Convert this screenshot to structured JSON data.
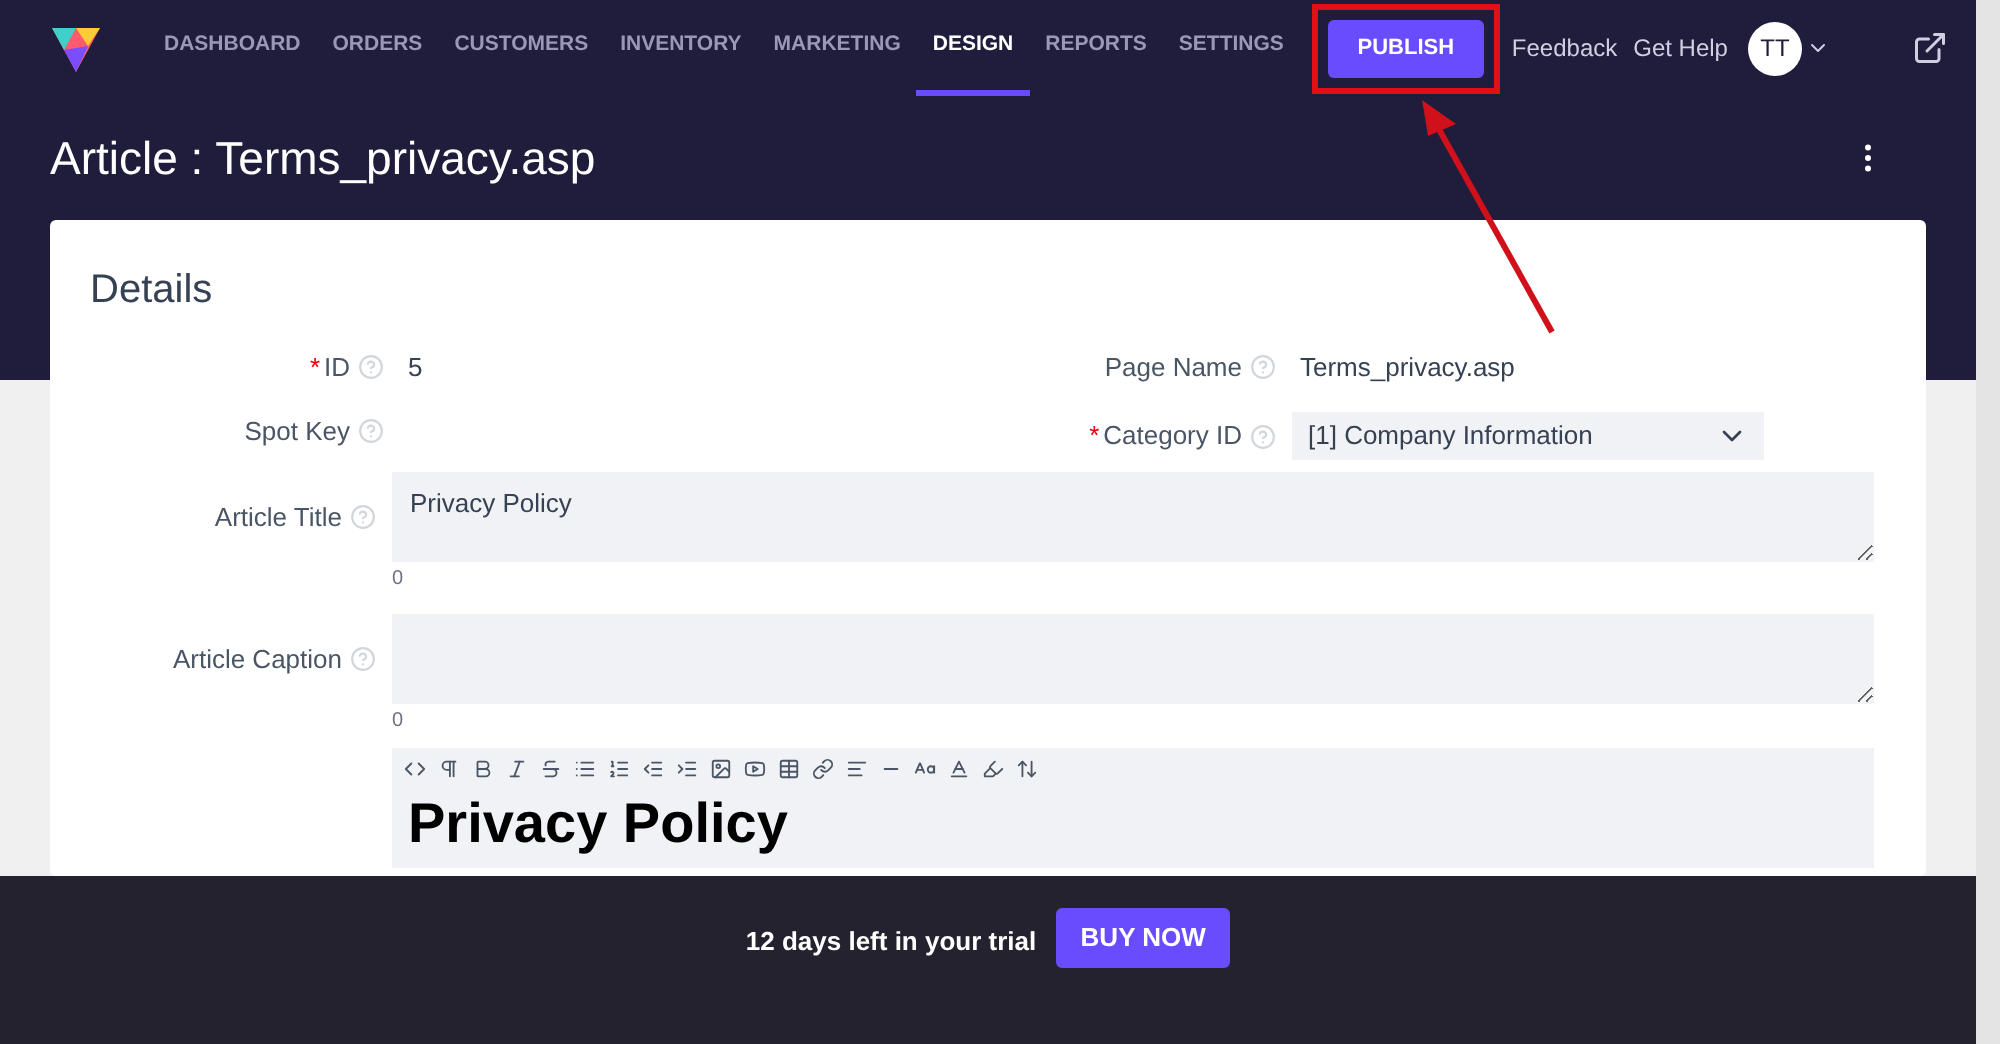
{
  "nav": {
    "items": [
      {
        "label": "DASHBOARD",
        "selected": false
      },
      {
        "label": "ORDERS",
        "selected": false
      },
      {
        "label": "CUSTOMERS",
        "selected": false
      },
      {
        "label": "INVENTORY",
        "selected": false
      },
      {
        "label": "MARKETING",
        "selected": false
      },
      {
        "label": "DESIGN",
        "selected": true
      },
      {
        "label": "REPORTS",
        "selected": false
      },
      {
        "label": "SETTINGS",
        "selected": false
      }
    ],
    "publish": "PUBLISH",
    "links": [
      "Feedback",
      "Get Help"
    ],
    "avatar": "TT"
  },
  "page_title": "Article : Terms_privacy.asp",
  "details": {
    "title": "Details",
    "row_1": [
      {
        "label": "ID",
        "required_mark": "*",
        "kind": "text",
        "value": "5"
      },
      {
        "label": "Page Name",
        "kind": "text",
        "value": "Terms_privacy.asp"
      }
    ],
    "row_2": [
      {
        "label": "Spot Key",
        "kind": "text"
      },
      {
        "label": "Category ID",
        "required_mark": "*",
        "kind": "select",
        "value": "[1] Company Information"
      }
    ],
    "textareas": [
      {
        "label": "Article Title",
        "value": "Privacy Policy",
        "count": "0"
      },
      {
        "label": "Article Caption",
        "count": "0"
      }
    ],
    "editor": {
      "heading": "Privacy Policy"
    }
  },
  "trial": {
    "text": "12 days left in your trial",
    "button": "BUY NOW"
  }
}
